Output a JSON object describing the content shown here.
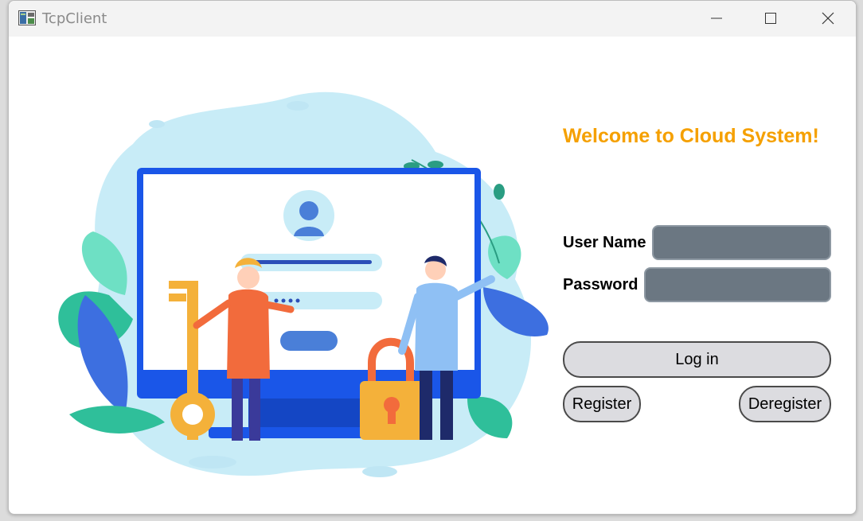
{
  "window": {
    "title": "TcpClient"
  },
  "title_controls": {
    "minimize_icon": "minimize-icon",
    "maximize_icon": "maximize-icon",
    "close_icon": "close-icon"
  },
  "login": {
    "welcome": "Welcome to Cloud System!",
    "username_label": "User Name",
    "username_value": "",
    "password_label": "Password",
    "password_value": "",
    "login_button": "Log in",
    "register_button": "Register",
    "deregister_button": "Deregister"
  },
  "colors": {
    "accent": "#f5a000",
    "field_bg": "#6b7782",
    "button_bg": "#dcdce0",
    "monitor_blue": "#1a56e8"
  }
}
